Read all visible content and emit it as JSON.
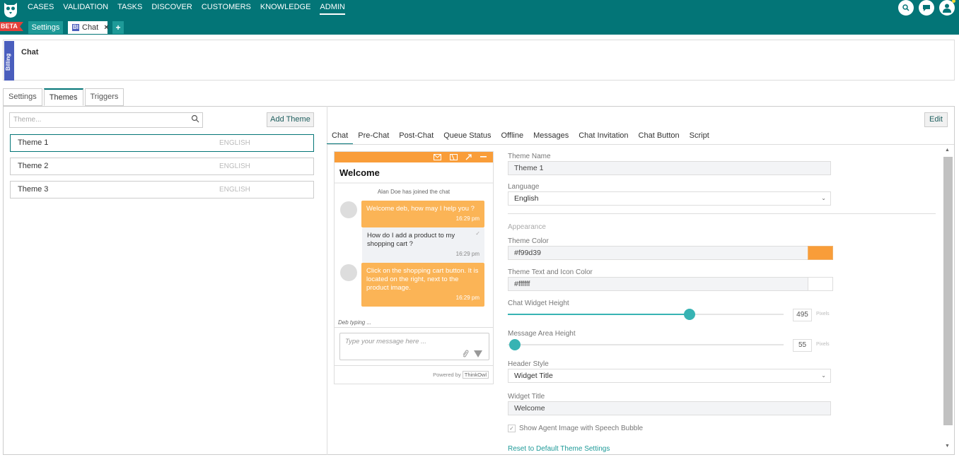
{
  "nav": {
    "items": [
      "CASES",
      "VALIDATION",
      "TASKS",
      "DISCOVER",
      "CUSTOMERS",
      "KNOWLEDGE",
      "ADMIN"
    ],
    "active": "ADMIN"
  },
  "tabs": {
    "beta": "BETA",
    "settings": "Settings",
    "chat_badge": "BI",
    "chat": "Chat",
    "close": "×",
    "plus": "+"
  },
  "header": {
    "side_label": "Billing",
    "title": "Chat"
  },
  "subtabs": [
    "Settings",
    "Themes",
    "Triggers"
  ],
  "themes": {
    "search_placeholder": "Theme...",
    "add_button": "Add Theme",
    "edit_button": "Edit",
    "items": [
      {
        "name": "Theme 1",
        "language": "ENGLISH"
      },
      {
        "name": "Theme 2",
        "language": "ENGLISH"
      },
      {
        "name": "Theme 3",
        "language": "ENGLISH"
      }
    ]
  },
  "content_tabs": [
    "Chat",
    "Pre-Chat",
    "Post-Chat",
    "Queue Status",
    "Offline",
    "Messages",
    "Chat Invitation",
    "Chat Button",
    "Script"
  ],
  "widget": {
    "title": "Welcome",
    "joined": "Alan Doe has joined the chat",
    "msg1": "Welcome deb, how may I help you ?",
    "msg1_time": "16:29 pm",
    "msg2": "How do I add a product to my shopping cart ?",
    "msg2_time": "16:29 pm",
    "msg3": "Click on the shopping cart button. It is located on the right, next to the product image.",
    "msg3_time": "16:29 pm",
    "typing": "Deb typing ...",
    "input_placeholder": "Type your message here ...",
    "powered_by": "Powered by",
    "brand": "ThinkOwl"
  },
  "form": {
    "theme_name_label": "Theme Name",
    "theme_name": "Theme 1",
    "language_label": "Language",
    "language": "English",
    "appearance": "Appearance",
    "theme_color_label": "Theme Color",
    "theme_color": "#f99d39",
    "text_color_label": "Theme Text and Icon Color",
    "text_color": "#ffffff",
    "height_label": "Chat Widget Height",
    "height_value": "495",
    "height_fraction": 0.66,
    "msg_area_label": "Message Area Height",
    "msg_area_value": "55",
    "msg_area_fraction": 0.0,
    "unit": "Pixels",
    "header_style_label": "Header Style",
    "header_style": "Widget Title",
    "widget_title_label": "Widget Title",
    "widget_title": "Welcome",
    "show_agent_image": "Show Agent Image with Speech Bubble",
    "reset_link": "Reset to Default Theme Settings"
  },
  "colors": {
    "teal": "#037577",
    "accent": "#1e9a98",
    "orange": "#f99d39",
    "slider": "#37b3b3",
    "beta": "#e2403a",
    "billing": "#4a5ebd"
  }
}
